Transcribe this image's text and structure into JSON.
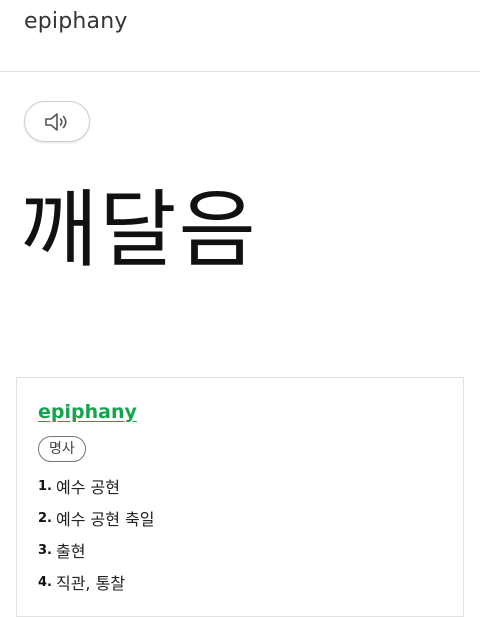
{
  "header": {
    "source_text": "epiphany"
  },
  "speaker": {
    "icon": "speaker-icon"
  },
  "result": {
    "translation": "깨달음"
  },
  "dictionary": {
    "word": "epiphany",
    "part_of_speech": "명사",
    "meanings": [
      {
        "num": "1.",
        "text": "예수 공현"
      },
      {
        "num": "2.",
        "text": "예수 공현 축일"
      },
      {
        "num": "3.",
        "text": "출현"
      },
      {
        "num": "4.",
        "text": "직관, 통찰"
      }
    ],
    "accent_color": "#14a44d"
  }
}
